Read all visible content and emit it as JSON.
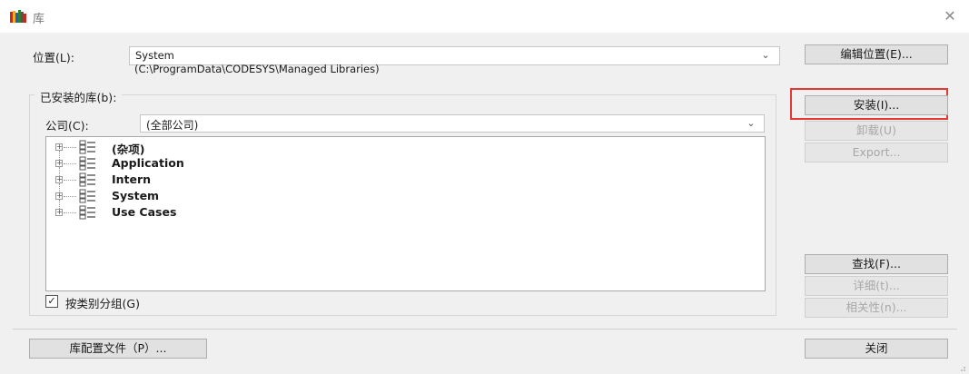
{
  "window": {
    "title": "库",
    "close_symbol": "✕",
    "icon": "library-books-icon"
  },
  "location": {
    "label": "位置(L):",
    "value": "System",
    "path": "(C:\\ProgramData\\CODESYS\\Managed Libraries)",
    "edit_button": "编辑位置(E)..."
  },
  "installed": {
    "group_title": "已安装的库(b):",
    "company_label": "公司(C):",
    "company_value": "(全部公司)",
    "tree_items": [
      {
        "label": "(杂项)"
      },
      {
        "label": "Application"
      },
      {
        "label": "Intern"
      },
      {
        "label": "System"
      },
      {
        "label": "Use Cases"
      }
    ],
    "group_by_category": {
      "label": "按类别分组(G)",
      "checked": true
    }
  },
  "buttons": {
    "install": "安装(I)...",
    "uninstall": "卸载(U)",
    "export": "Export...",
    "find": "查找(F)...",
    "details": "详细(t)...",
    "dependencies": "相关性(n)...",
    "profile": "库配置文件（P）...",
    "close": "关闭"
  },
  "colors": {
    "highlight": "#e53935",
    "dialog_bg": "#f0f0f0"
  }
}
